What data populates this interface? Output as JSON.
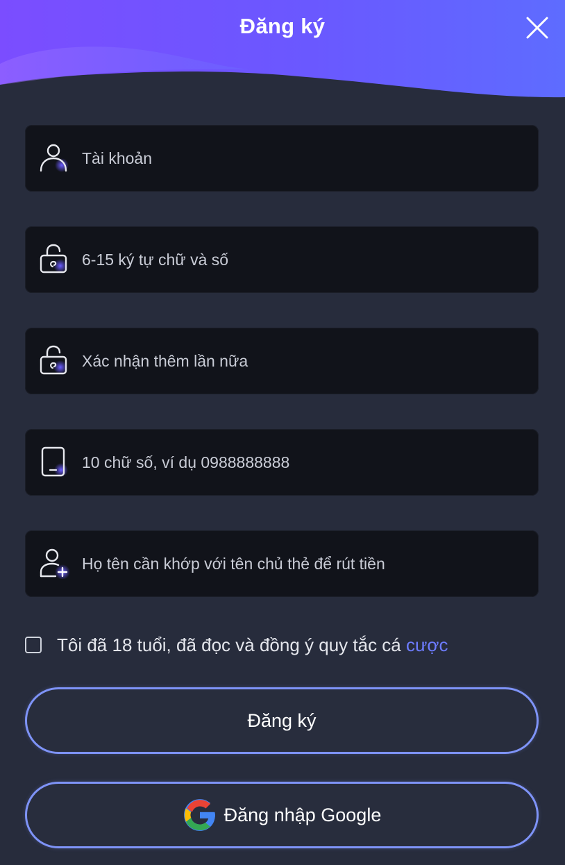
{
  "header": {
    "title": "Đăng ký",
    "close_icon": "close-icon"
  },
  "colors": {
    "header_gradient_start": "#7b4dff",
    "header_gradient_end": "#5e6cff",
    "background": "#272c3c",
    "field_background": "#11131a",
    "accent_blue": "#7e93f7",
    "link": "#6d7cff"
  },
  "form": {
    "username": {
      "placeholder": "Tài khoản",
      "icon": "user-icon"
    },
    "password": {
      "placeholder": "6-15 ký tự chữ và số",
      "icon": "lock-icon"
    },
    "confirm_password": {
      "placeholder": "Xác nhận thêm lần nữa",
      "icon": "lock-icon"
    },
    "phone": {
      "placeholder": "10 chữ số, ví dụ 0988888888",
      "icon": "phone-icon"
    },
    "full_name": {
      "placeholder": "Họ tên cần khớp với tên chủ thẻ để rút tiền",
      "icon": "add-user-icon"
    }
  },
  "agreement": {
    "text": "Tôi đã 18 tuổi, đã đọc và đồng ý quy tắc cá ",
    "link": "cược",
    "checked": false
  },
  "buttons": {
    "register": "Đăng ký",
    "google_login": "Đăng nhập Google",
    "google_icon": "google-icon"
  }
}
